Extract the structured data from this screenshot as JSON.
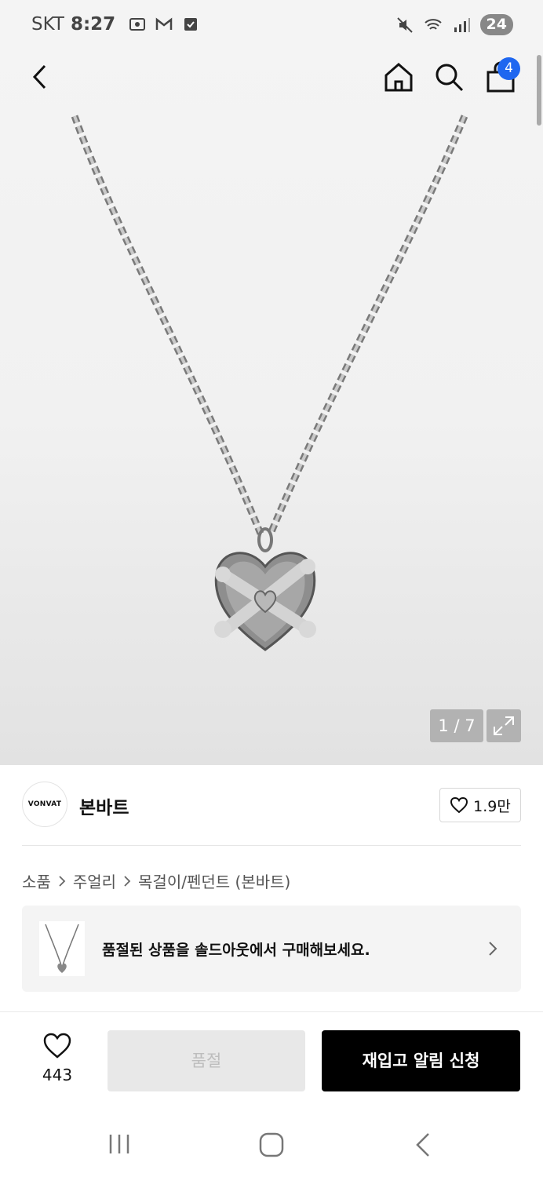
{
  "status_bar": {
    "carrier": "SKT",
    "time": "8:27",
    "battery": "24",
    "icons_left": [
      "screenshot-icon",
      "gmail-icon",
      "check-box-icon"
    ],
    "icons_right": [
      "mute-icon",
      "wifi-icon",
      "signal-icon"
    ]
  },
  "top_bar": {
    "icons": [
      "back-icon",
      "home-icon",
      "search-icon",
      "cart-icon"
    ],
    "cart_count": "4"
  },
  "gallery": {
    "counter": "1 / 7",
    "expand_icon": "expand-icon",
    "image_description_icon": "heart-pendant-necklace"
  },
  "brand": {
    "logo_text": "VONVAT",
    "name": "본바트",
    "likes": "1.9만"
  },
  "breadcrumb": {
    "items": [
      "소품",
      "주얼리",
      "목걸이/펜던트 (본바트)"
    ]
  },
  "soldout_banner": {
    "text": "품절된 상품을 솔드아웃에서 구매해보세요."
  },
  "bottom_bar": {
    "wish_count": "443",
    "soldout_label": "품절",
    "restock_label": "재입고 알림 신청"
  },
  "colors": {
    "accent": "#1f67f0",
    "primary_button": "#000000",
    "disabled_button": "#e8e8e8"
  }
}
